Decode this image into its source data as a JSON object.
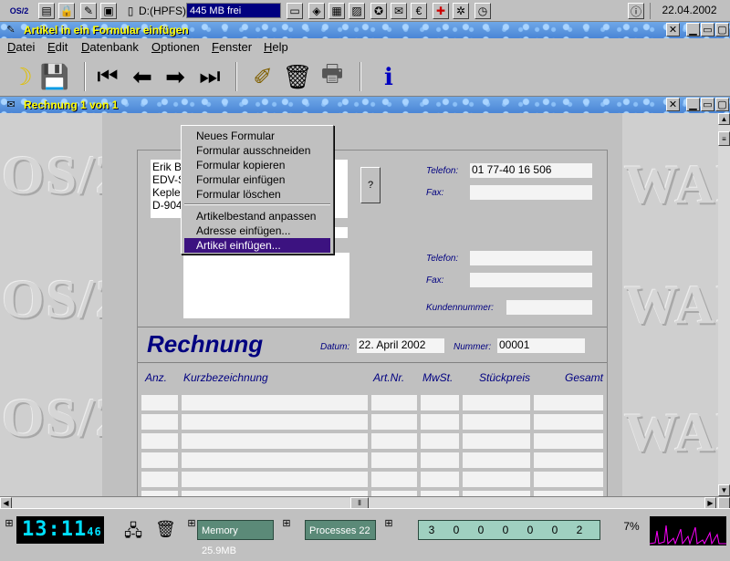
{
  "topbar": {
    "drive_label": "D:(HPFS)",
    "drive_free": "445 MB frei",
    "date": "22.04.2002",
    "icons": [
      "os2-logo-icon",
      "folder-icon",
      "lock-icon",
      "tool-icon",
      "monitor-icon",
      "disk-icon",
      "network-icon",
      "drive-icon",
      "document-icon",
      "photo-icon",
      "settings-icon",
      "mail-icon",
      "euro-icon",
      "firstaid-icon",
      "gear-icon",
      "clock-icon",
      "help-icon"
    ]
  },
  "window": {
    "title": "Artikel in ein Formular einfügen"
  },
  "menubar": [
    "Datei",
    "Edit",
    "Datenbank",
    "Optionen",
    "Fenster",
    "Help"
  ],
  "toolbar": [
    "banana-icon",
    "save-disk-icon",
    "first-record-icon",
    "prev-record-icon",
    "next-record-icon",
    "last-record-icon",
    "eraser-icon",
    "trash-icon",
    "print-icon",
    "info-icon"
  ],
  "subwindow": {
    "title": "Rechnung   1 von 1"
  },
  "form": {
    "address_lines": [
      "Erik B",
      "EDV-S",
      "Kepler",
      "D-904"
    ],
    "help_button": "?",
    "labels": {
      "telefon": "Telefon:",
      "fax": "Fax:",
      "telefon2": "Telefon:",
      "fax2": "Fax:",
      "kundennummer": "Kundennummer:",
      "datum": "Datum:",
      "nummer": "Nummer:"
    },
    "telefon_value": "01 77-40 16 506",
    "heading": "Rechnung",
    "datum_value": "22. April 2002",
    "nummer_value": "00001",
    "columns": [
      "Anz.",
      "Kurzbezeichnung",
      "Art.Nr.",
      "MwSt.",
      "Stückpreis",
      "Gesamt"
    ]
  },
  "context_menu": {
    "items": [
      "Neues Formular",
      "Formular ausschneiden",
      "Formular kopieren",
      "Formular einfügen",
      "Formular löschen",
      "Artikelbestand anpassen",
      "Adresse einfügen...",
      "Artikel einfügen..."
    ],
    "selected": "Artikel einfügen..."
  },
  "watermark": [
    "OS/2",
    "WAR",
    "OS/2",
    "WAR",
    "OS/2",
    "WAR"
  ],
  "bottombar": {
    "time": "13:11",
    "seconds": "46",
    "memory": "Memory 25.9MB",
    "processes": "Processes 22",
    "counters": [
      "3",
      "0",
      "0",
      "0",
      "0",
      "0",
      "2"
    ],
    "cpu_percent": "7%",
    "colors": {
      "display_bg": "#000000",
      "display_fg": "#00e0ff",
      "graph": "#ff00ff"
    }
  }
}
